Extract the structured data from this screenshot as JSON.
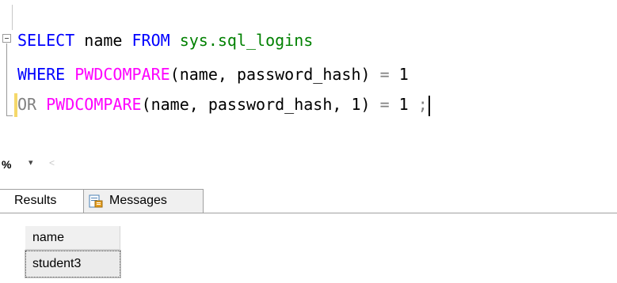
{
  "editor": {
    "line1": {
      "kw": "SELECT",
      "col": " name ",
      "kw2": "FROM",
      "sp": " ",
      "obj": "sys.sql_logins"
    },
    "line2": {
      "kw": "WHERE",
      "sp": " ",
      "fn": "PWDCOMPARE",
      "args": "(name, password_hash)",
      "eq": " = ",
      "num": "1"
    },
    "line3": {
      "op": "OR",
      "sp": " ",
      "fn": "PWDCOMPARE",
      "args": "(name, password_hash, 1)",
      "eq": " = ",
      "num": "1 ",
      "semi": ";"
    }
  },
  "zoom": {
    "value": "%",
    "dropdown_glyph": "▾",
    "scroll_glyph": "<"
  },
  "tabs": {
    "results": "Results",
    "messages": "Messages"
  },
  "grid": {
    "column": "name",
    "rows": [
      "student3"
    ]
  },
  "colors": {
    "keyword": "#0000ff",
    "function": "#ff00ff",
    "system_object": "#008000",
    "operator": "#808080"
  }
}
